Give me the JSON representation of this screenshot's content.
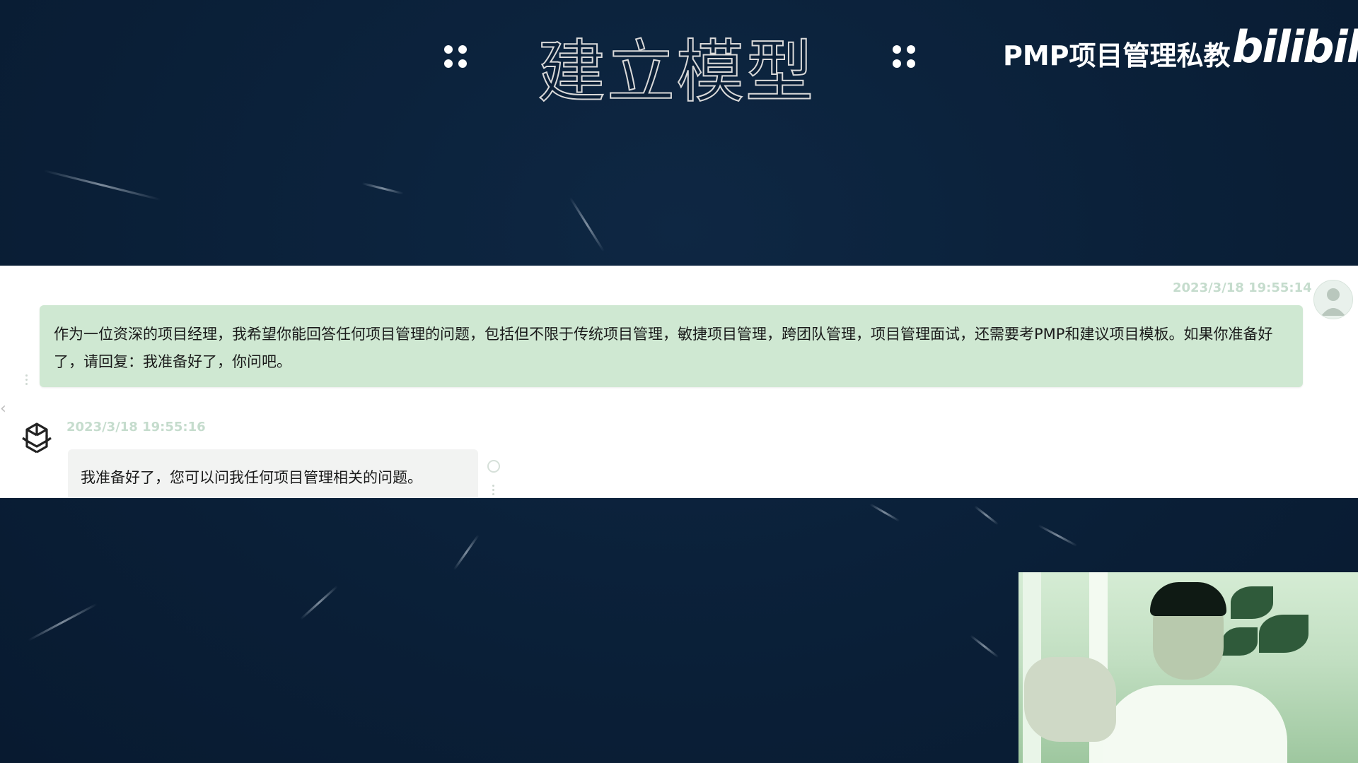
{
  "header": {
    "title": "建立模型",
    "brand_text": "PMP项目管理私教",
    "brand_logo": "bilibili",
    "dots_icon": "four-dots-icon"
  },
  "chat": {
    "user_message": {
      "timestamp": "2023/3/18 19:55:14",
      "text": "作为一位资深的项目经理，我希望你能回答任何项目管理的问题，包括但不限于传统项目管理，敏捷项目管理，跨团队管理，项目管理面试，还需要考PMP和建议项目模板。如果你准备好了，请回复：我准备好了，你问吧。",
      "avatar_icon": "user-avatar-icon"
    },
    "bot_message": {
      "timestamp": "2023/3/18 19:55:16",
      "text": "我准备好了，您可以问我任何项目管理相关的问题。",
      "avatar_icon": "openai-logo-icon"
    }
  },
  "colors": {
    "background": "#0b2038",
    "user_bubble": "#cfe8d2",
    "bot_bubble": "#f2f3f2",
    "timestamp": "#c5dccd"
  }
}
